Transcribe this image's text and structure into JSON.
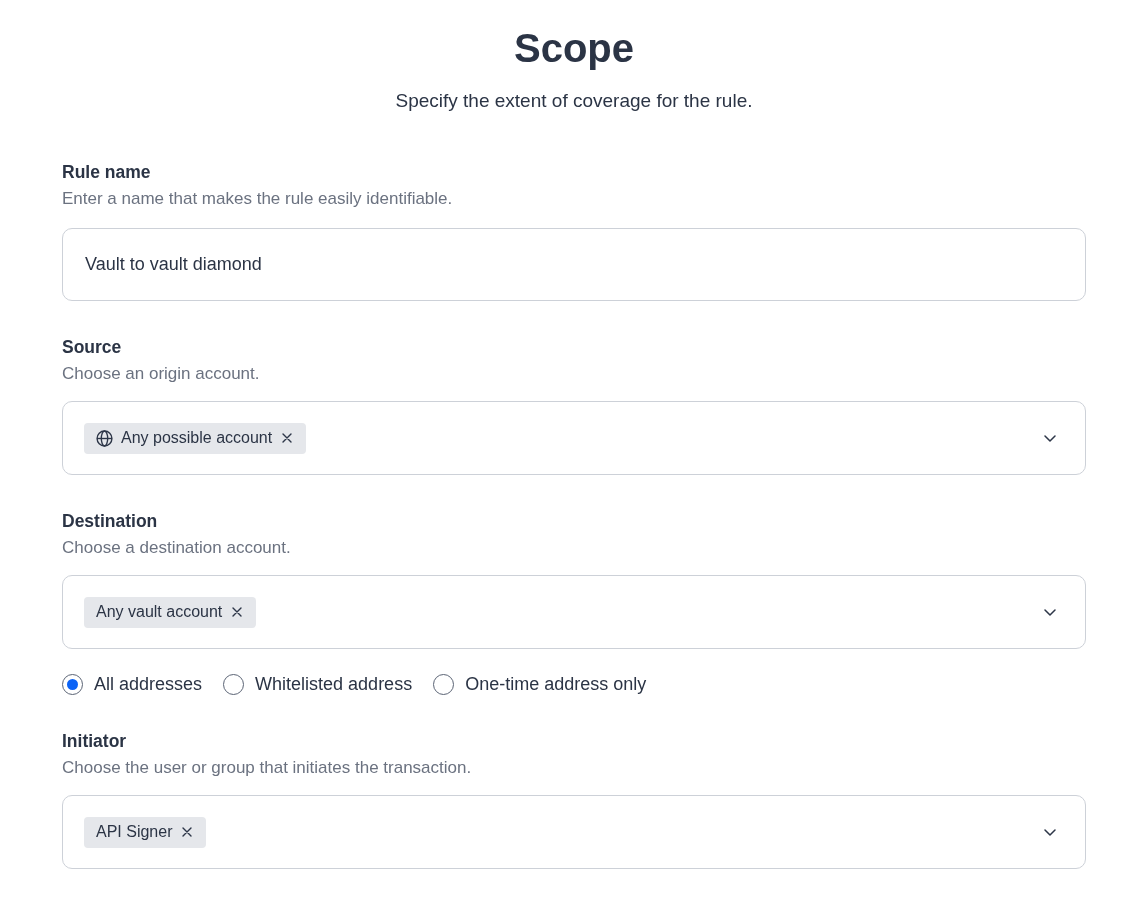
{
  "header": {
    "title": "Scope",
    "subtitle": "Specify the extent of coverage for the rule."
  },
  "fields": [
    {
      "kind": "text",
      "label": "Rule name",
      "hint": "Enter a name that makes the rule easily identifiable.",
      "value": "Vault to vault diamond"
    },
    {
      "kind": "select",
      "label": "Source",
      "hint": "Choose an origin account.",
      "chips": [
        {
          "kind": "icon",
          "text": "Any possible account"
        }
      ]
    },
    {
      "kind": "select",
      "label": "Destination",
      "hint": "Choose a destination account.",
      "chips": [
        {
          "kind": "plain",
          "text": "Any vault account"
        }
      ],
      "options": [
        {
          "label": "All addresses",
          "selected": true
        },
        {
          "label": "Whitelisted address",
          "selected": false
        },
        {
          "label": "One-time address only",
          "selected": false
        }
      ]
    },
    {
      "kind": "select",
      "label": "Initiator",
      "hint": "Choose the user or group that initiates the transaction.",
      "chips": [
        {
          "kind": "plain",
          "text": "API Signer"
        }
      ]
    }
  ]
}
